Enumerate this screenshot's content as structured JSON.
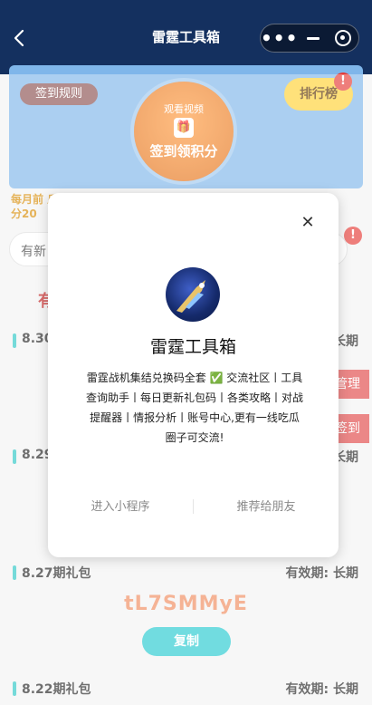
{
  "topbar": {
    "title": "雷霆工具箱",
    "back_icon": "back-arrow-icon"
  },
  "banner": {
    "rules_label": "签到规则",
    "rank_label": "排行榜",
    "rank_badge": "!",
    "signin_top": "观看视频",
    "signin_main": "签到领积分"
  },
  "monthly_note": "每月前 瓜分20",
  "search": {
    "text": "有新"
  },
  "red_partial": "有",
  "gifts": [
    {
      "title": "8.30",
      "valid": "长期"
    },
    {
      "title": "8.29",
      "valid": "长期"
    },
    {
      "title": "8.27期礼包",
      "valid": "有效期: 长期"
    },
    {
      "title": "8.22期礼包",
      "valid": "有效期: 长期"
    }
  ],
  "side_buttons": {
    "manage": "管理",
    "signin": "签到"
  },
  "featured_code": {
    "code": "tL7SMMyE",
    "copy_label": "复制"
  },
  "modal": {
    "title": "雷霆工具箱",
    "description": "雷霆战机集结兑换码全套 ✅ 交流社区丨工具查询助手丨每日更新礼包码丨各类攻略丨对战提醒器丨情报分析丨账号中心,更有一线吃瓜圈子可交流!",
    "enter_label": "进入小程序",
    "recommend_label": "推荐给朋友",
    "close_icon": "close-icon"
  },
  "colors": {
    "topbar": "#14305f",
    "accent_teal": "#25c9d0",
    "code_orange": "#f08a5d",
    "red": "#e04848"
  }
}
